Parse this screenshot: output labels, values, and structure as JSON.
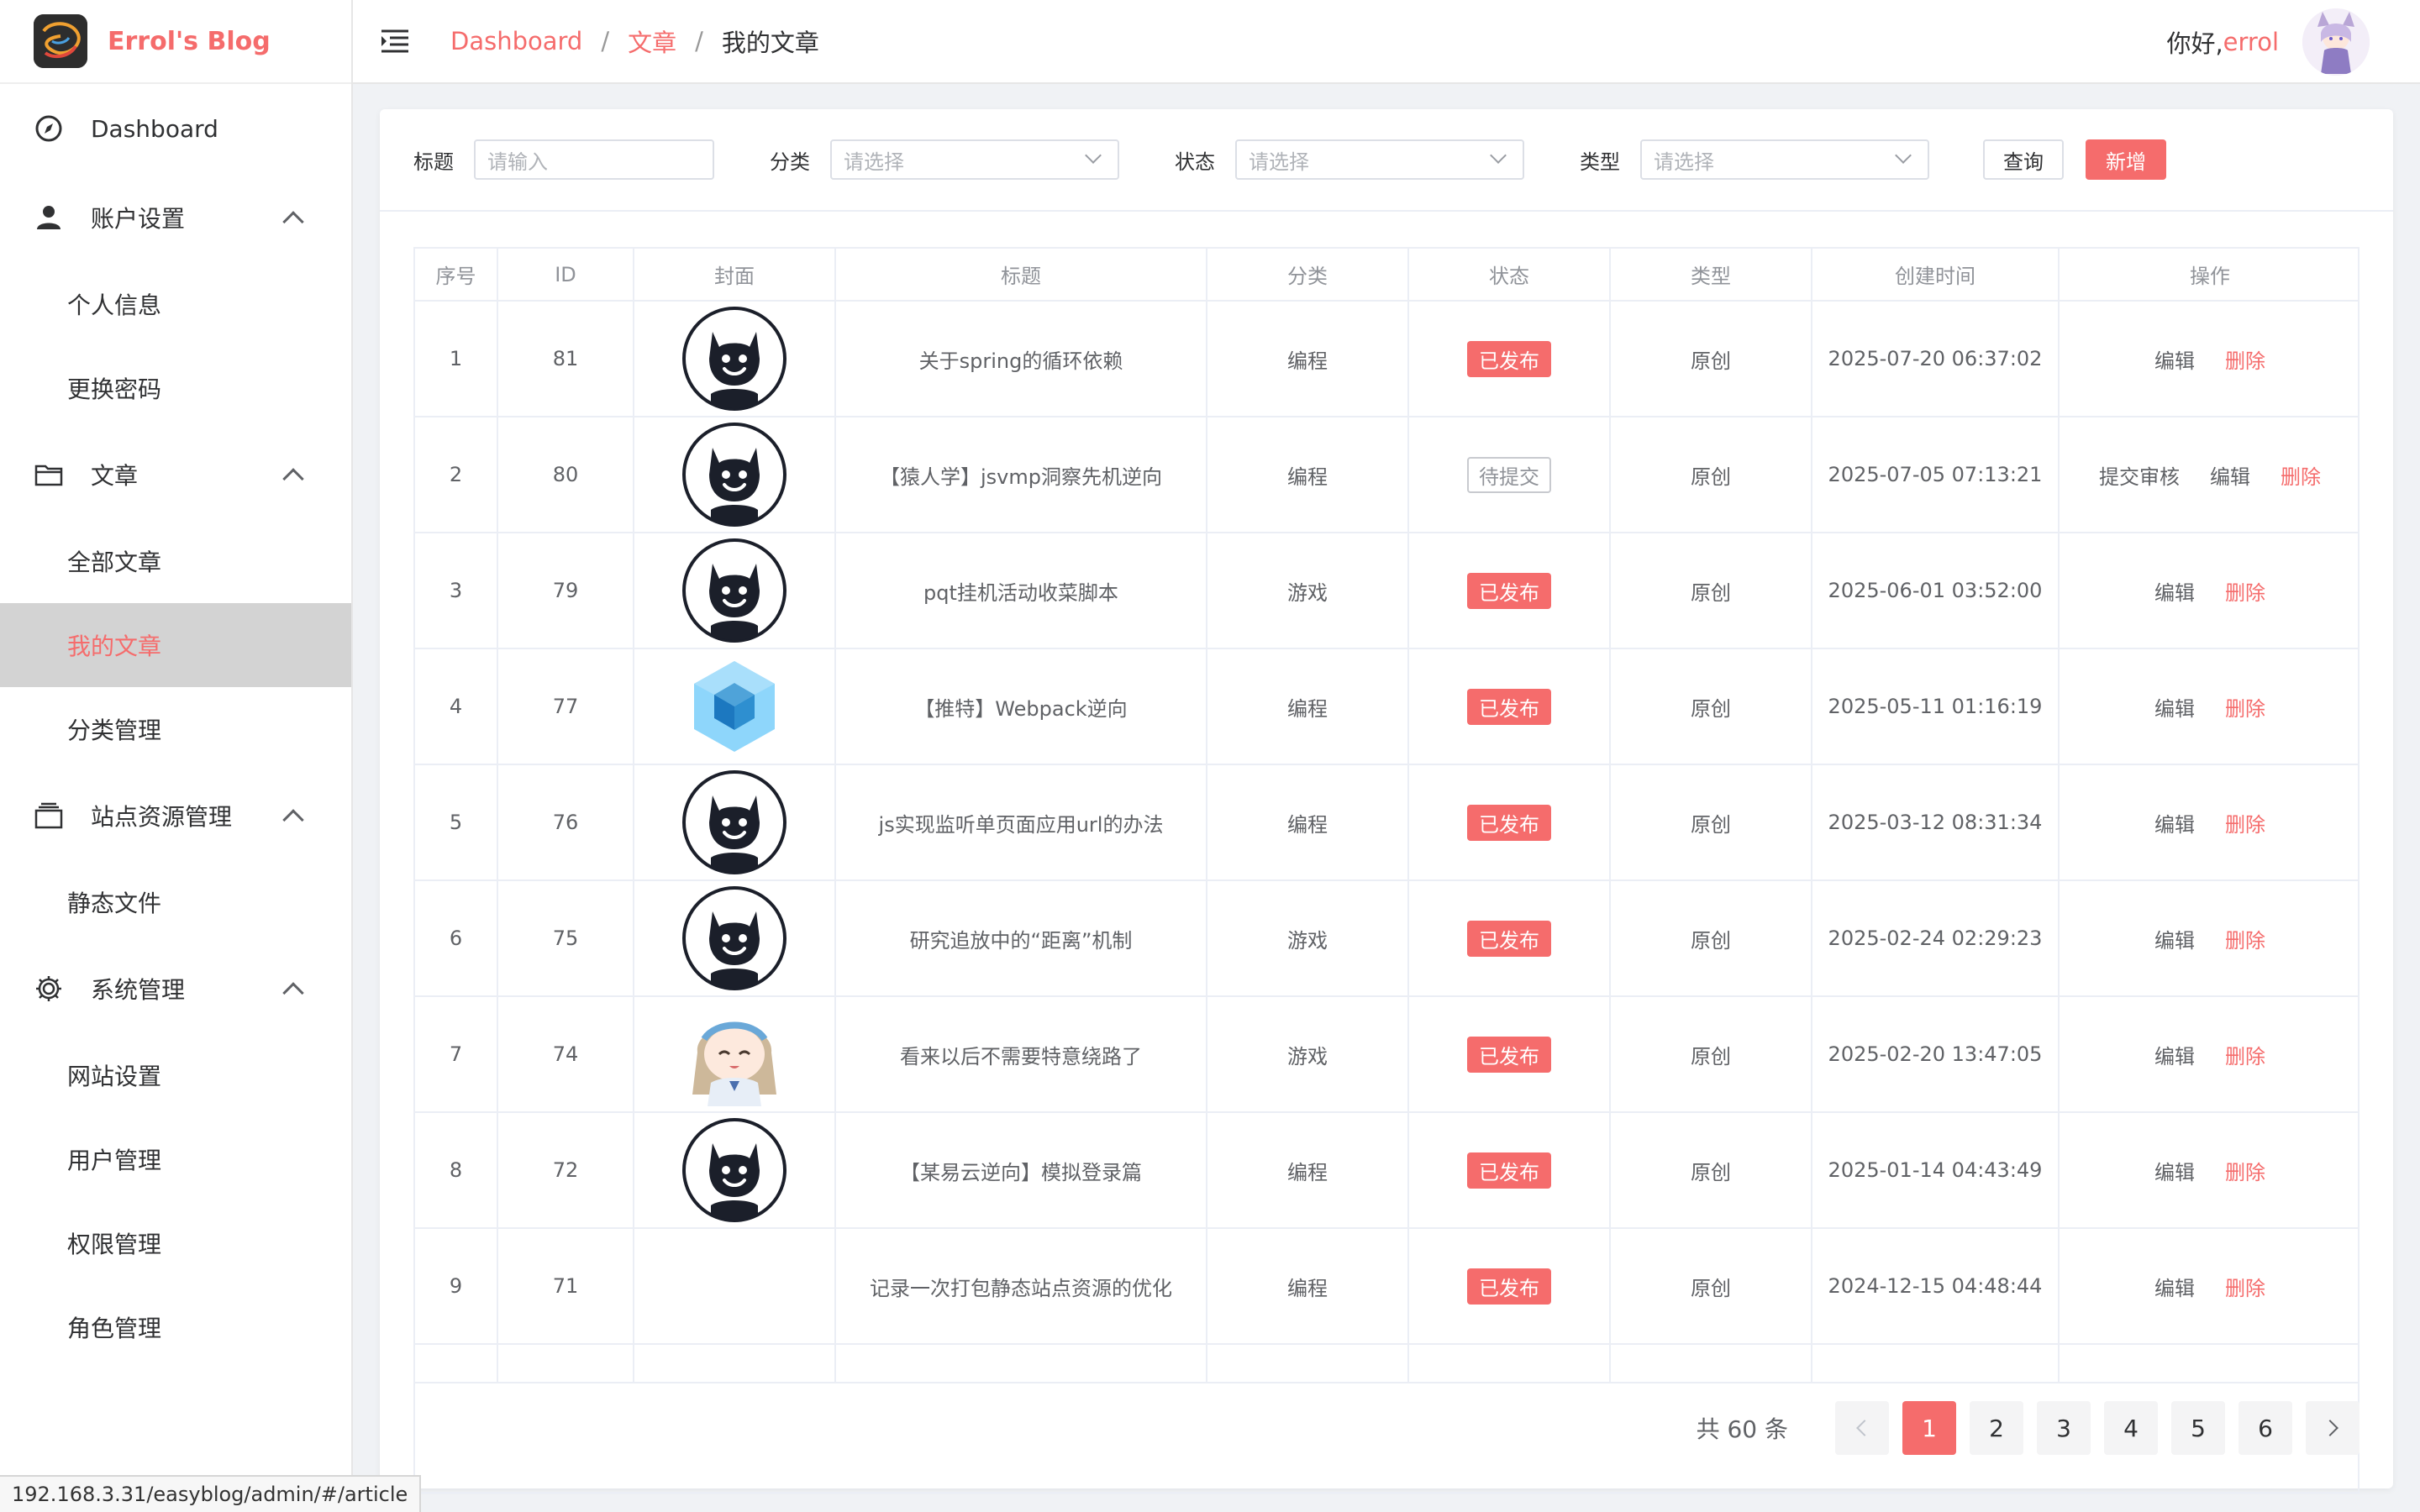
{
  "app": {
    "brand": "Errol's Blog"
  },
  "sidebar": {
    "dashboard": "Dashboard",
    "account": {
      "label": "账户设置",
      "children": [
        "个人信息",
        "更换密码"
      ]
    },
    "articles": {
      "label": "文章",
      "children": [
        "全部文章",
        "我的文章",
        "分类管理"
      ]
    },
    "resources": {
      "label": "站点资源管理",
      "children": [
        "静态文件"
      ]
    },
    "system": {
      "label": "系统管理",
      "children": [
        "网站设置",
        "用户管理",
        "权限管理",
        "角色管理"
      ]
    }
  },
  "header": {
    "breadcrumb": [
      "Dashboard",
      "文章",
      "我的文章"
    ],
    "greeting": "你好,",
    "username": "errol"
  },
  "filters": {
    "title_label": "标题",
    "title_placeholder": "请输入",
    "category_label": "分类",
    "category_placeholder": "请选择",
    "status_label": "状态",
    "status_placeholder": "请选择",
    "type_label": "类型",
    "type_placeholder": "请选择",
    "query_button": "查询",
    "add_button": "新增"
  },
  "table": {
    "columns": [
      "序号",
      "ID",
      "封面",
      "标题",
      "分类",
      "状态",
      "类型",
      "创建时间",
      "操作"
    ],
    "rows": [
      {
        "no": "1",
        "id": "81",
        "cover": "github-cat",
        "title": "关于spring的循环依赖",
        "category": "编程",
        "status": "已发布",
        "type": "原创",
        "created": "2025-07-20 06:37:02"
      },
      {
        "no": "2",
        "id": "80",
        "cover": "github-cat",
        "title": "【猿人学】jsvmp洞察先机逆向",
        "category": "编程",
        "status": "待提交",
        "type": "原创",
        "created": "2025-07-05 07:13:21"
      },
      {
        "no": "3",
        "id": "79",
        "cover": "github-cat",
        "title": "pqt挂机活动收菜脚本",
        "category": "游戏",
        "status": "已发布",
        "type": "原创",
        "created": "2025-06-01 03:52:00"
      },
      {
        "no": "4",
        "id": "77",
        "cover": "webpack-cube",
        "title": "【推特】Webpack逆向",
        "category": "编程",
        "status": "已发布",
        "type": "原创",
        "created": "2025-05-11 01:16:19"
      },
      {
        "no": "5",
        "id": "76",
        "cover": "github-cat",
        "title": "js实现监听单页面应用url的办法",
        "category": "编程",
        "status": "已发布",
        "type": "原创",
        "created": "2025-03-12 08:31:34"
      },
      {
        "no": "6",
        "id": "75",
        "cover": "github-cat",
        "title": "研究追放中的“距离”机制",
        "category": "游戏",
        "status": "已发布",
        "type": "原创",
        "created": "2025-02-24 02:29:23"
      },
      {
        "no": "7",
        "id": "74",
        "cover": "anime-girl",
        "title": "看来以后不需要特意绕路了",
        "category": "游戏",
        "status": "已发布",
        "type": "原创",
        "created": "2025-02-20 13:47:05"
      },
      {
        "no": "8",
        "id": "72",
        "cover": "github-cat",
        "title": "【某易云逆向】模拟登录篇",
        "category": "编程",
        "status": "已发布",
        "type": "原创",
        "created": "2025-01-14 04:43:49"
      },
      {
        "no": "9",
        "id": "71",
        "cover": "",
        "title": "记录一次打包静态站点资源的优化",
        "category": "编程",
        "status": "已发布",
        "type": "原创",
        "created": "2024-12-15 04:48:44"
      }
    ],
    "actions": {
      "submit": "提交审核",
      "edit": "编辑",
      "delete": "删除"
    }
  },
  "pagination": {
    "total_text": "共 60 条",
    "pages": [
      "1",
      "2",
      "3",
      "4",
      "5",
      "6"
    ],
    "current": "1"
  },
  "status_bar": {
    "url": "192.168.3.31/easyblog/admin/#/article"
  },
  "colors": {
    "accent": "#f56c6c",
    "active_menu_bg": "#d3d3d3"
  }
}
